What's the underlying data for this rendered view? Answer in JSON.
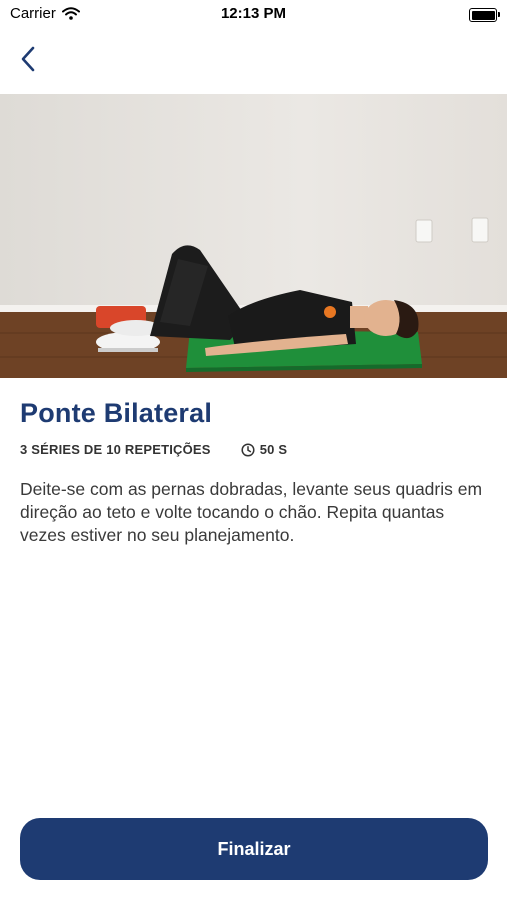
{
  "status_bar": {
    "carrier": "Carrier",
    "time": "12:13 PM"
  },
  "icons": {
    "back": "chevron-left-icon",
    "wifi": "wifi-icon",
    "battery": "battery-icon",
    "clock": "clock-icon"
  },
  "exercise": {
    "title": "Ponte Bilateral",
    "sets_reps": "3 SÉRIES DE 10 REPETIÇÕES",
    "duration": "50 S",
    "description": "Deite-se com as pernas dobradas, levante seus quadris em direção ao teto e volte tocando o chão. Repita quantas vezes estiver no seu planejamento."
  },
  "actions": {
    "finish_label": "Finalizar"
  },
  "colors": {
    "primary": "#1e3b72",
    "mat": "#1f8f3a",
    "floor": "#6e4225",
    "wall": "#e6e3df"
  }
}
